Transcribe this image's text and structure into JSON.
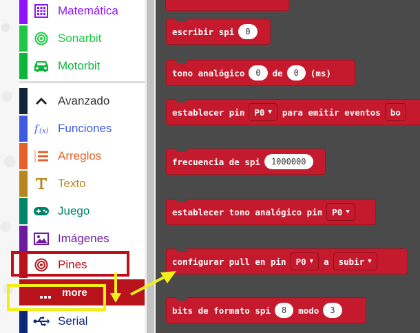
{
  "toolbox": {
    "categories": [
      {
        "label": "Matemática",
        "icon": "calculator-icon",
        "color": "#9013fe",
        "text_color": "#9013fe"
      },
      {
        "label": "Sonarbit",
        "icon": "sonar-target-icon",
        "color": "#1ec845",
        "text_color": "#1ec845"
      },
      {
        "label": "Motorbit",
        "icon": "car-icon",
        "color": "#0bb63a",
        "text_color": "#0bb63a"
      },
      {
        "label": "Avanzado",
        "icon": "chevron-up-icon",
        "color": "#13233a",
        "text_color": "#333333"
      },
      {
        "label": "Funciones",
        "icon": "function-icon",
        "color": "#3d5ae0",
        "text_color": "#3d5ae0"
      },
      {
        "label": "Arreglos",
        "icon": "list-icon",
        "color": "#e4612a",
        "text_color": "#e4612a"
      },
      {
        "label": "Texto",
        "icon": "text-icon",
        "color": "#b8861e",
        "text_color": "#b8861e"
      },
      {
        "label": "Juego",
        "icon": "gamepad-icon",
        "color": "#00856b",
        "text_color": "#00856b"
      },
      {
        "label": "Imágenes",
        "icon": "image-icon",
        "color": "#6e1a9c",
        "text_color": "#6e1a9c"
      },
      {
        "label": "Pines",
        "icon": "pin-target-icon",
        "color": "#b8121b",
        "text_color": "#b8121b"
      },
      {
        "label": "Serial",
        "icon": "usb-icon",
        "color": "#0c2878",
        "text_color": "#0c2878"
      }
    ],
    "more_label": "more"
  },
  "blocks": {
    "escribir_spi": {
      "text": "escribir spi",
      "value": "0"
    },
    "tono_analogico": {
      "text": "tono analógico",
      "value1": "0",
      "mid": "de",
      "value2": "0",
      "unit": "(ms)"
    },
    "establecer_pin": {
      "text": "establecer pin",
      "pin": "P0",
      "mid": "para emitir eventos",
      "tail": "bo"
    },
    "frecuencia_spi": {
      "text": "frecuencia de spi",
      "value": "1000000"
    },
    "establecer_tono": {
      "text": "establecer tono analógico pin",
      "pin": "P0"
    },
    "configurar_pull": {
      "text": "configurar pull en pin",
      "pin": "P0",
      "mid": "a",
      "mode": "subir"
    },
    "bits_formato": {
      "text": "bits de formato spi",
      "value1": "8",
      "mid": "modo",
      "value2": "3"
    }
  },
  "colors": {
    "block": "#c5192d",
    "workspace": "#4a4a4a",
    "highlight_red": "#c00d19",
    "highlight_yellow": "#f2ef18"
  }
}
